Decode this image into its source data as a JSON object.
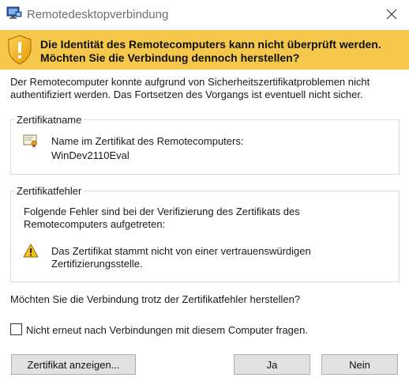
{
  "window": {
    "title": "Remotedesktopverbindung"
  },
  "banner": {
    "line1": "Die Identität des Remotecomputers kann nicht überprüft werden.",
    "line2": "Möchten Sie die Verbindung dennoch herstellen?",
    "color": "#f5c84b"
  },
  "intro": "Der Remotecomputer konnte aufgrund von Sicherheitszertifikatproblemen nicht authentifiziert werden. Das Fortsetzen des Vorgangs ist eventuell nicht sicher.",
  "cert_name": {
    "legend": "Zertifikatname",
    "label": "Name im Zertifikat des Remotecomputers:",
    "value": "WinDev2110Eval",
    "icon": "certificate-icon"
  },
  "cert_errors": {
    "legend": "Zertifikatfehler",
    "description": "Folgende Fehler sind bei der Verifizierung des Zertifikats des Remotecomputers aufgetreten:",
    "error_text": "Das Zertifikat stammt nicht von einer vertrauenswürdigen Zertifizierungsstelle.",
    "icon": "warning-icon"
  },
  "question": "Möchten Sie die Verbindung trotz der Zertifikatfehler herstellen?",
  "dont_ask": {
    "label": "Nicht erneut nach Verbindungen mit diesem Computer fragen.",
    "checked": false
  },
  "buttons": {
    "view_cert": "Zertifikat anzeigen...",
    "yes": "Ja",
    "no": "Nein"
  }
}
